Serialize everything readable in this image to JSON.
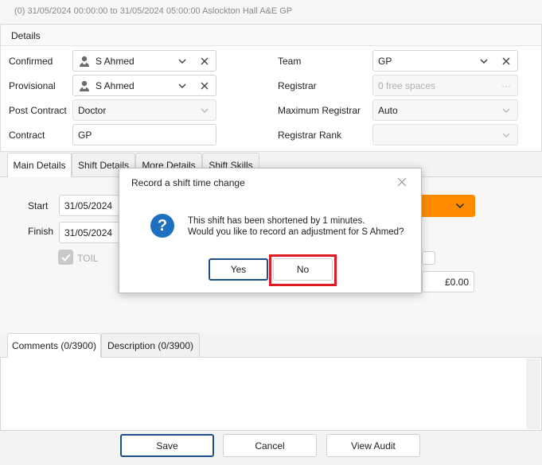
{
  "header": {
    "title": "(0) 31/05/2024 00:00:00 to 31/05/2024 05:00:00 Aslockton Hall A&E GP"
  },
  "details": {
    "title": "Details",
    "left": [
      {
        "label": "Confirmed",
        "value": "S Ahmed",
        "icon": "person-icon",
        "clearable": true
      },
      {
        "label": "Provisional",
        "value": "S Ahmed",
        "icon": "person-icon",
        "clearable": true
      },
      {
        "label": "Post Contract",
        "value": "Doctor"
      },
      {
        "label": "Contract",
        "value": "GP"
      }
    ],
    "right": [
      {
        "label": "Team",
        "value": "GP"
      },
      {
        "label": "Registrar",
        "placeholder": "0 free spaces"
      },
      {
        "label": "Maximum Registrar",
        "value": "Auto"
      },
      {
        "label": "Registrar Rank",
        "value": ""
      }
    ]
  },
  "tabs": [
    {
      "label": "Main Details"
    },
    {
      "label": "Shift Details"
    },
    {
      "label": "More Details"
    },
    {
      "label": "Shift Skills"
    }
  ],
  "main": {
    "start_label": "Start",
    "start_date": "31/05/2024",
    "finish_label": "Finish",
    "finish_date": "31/05/2024",
    "toil_label": "TOIL",
    "amount": "£0.00",
    "accent_color": "#ff8c00"
  },
  "comment_tabs": [
    {
      "label": "Comments (0/3900)"
    },
    {
      "label": "Description (0/3900)"
    }
  ],
  "footer": {
    "save": "Save",
    "cancel": "Cancel",
    "view_audit": "View Audit"
  },
  "dialog": {
    "title": "Record a shift time change",
    "message_line1": "This shift has been shortened by 1 minutes.",
    "message_line2": "Would you like to record an adjustment for S Ahmed?",
    "yes": "Yes",
    "no": "No",
    "icon": "question-icon",
    "highlight_color": "#e01b24"
  }
}
